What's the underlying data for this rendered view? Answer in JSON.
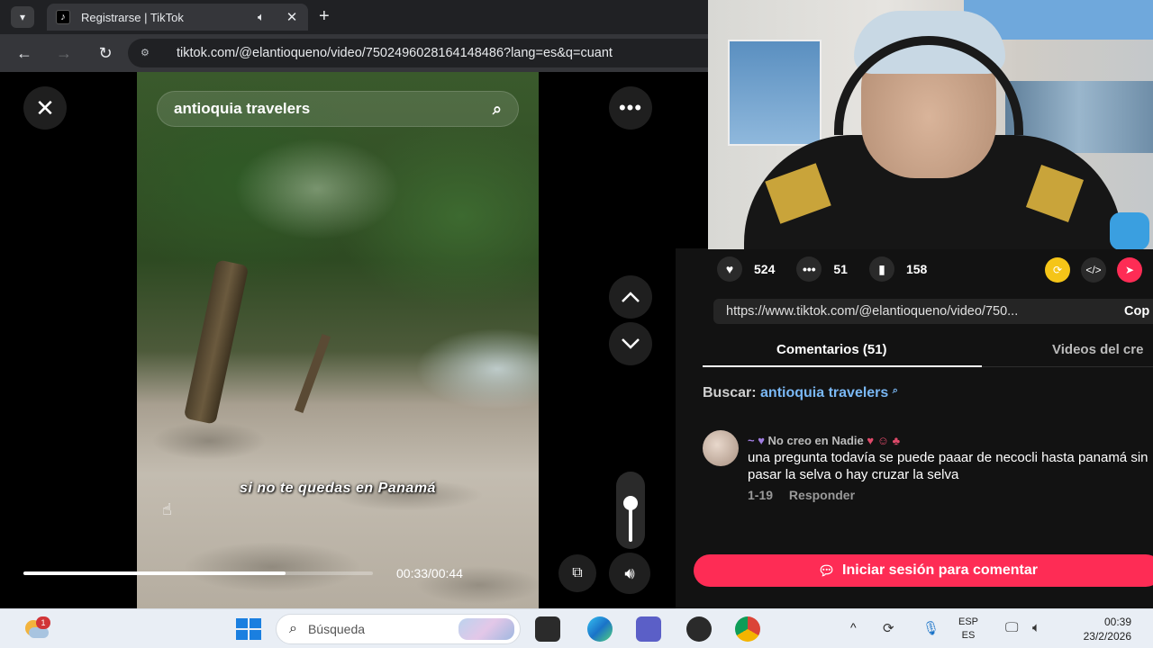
{
  "browser": {
    "tab_title": "Registrarse | TikTok",
    "favicon": "tiktok-logo-icon",
    "url": "tiktok.com/@elantioqueno/video/7502496028164148486?lang=es&q=cuant",
    "icons": [
      "tab-list-icon",
      "speaker-icon",
      "close-icon",
      "new-tab-icon",
      "back-icon",
      "forward-icon",
      "reload-icon",
      "site-info-icon"
    ]
  },
  "player": {
    "search_text": "antioquia travelers",
    "caption": "si no te quedas en Panamá",
    "time": "00:33/00:44",
    "progress": 0.75,
    "volume": 0.62
  },
  "stats": {
    "likes": "524",
    "comments": "51",
    "saves": "158"
  },
  "share_url": "https://www.tiktok.com/@elantioqueno/video/750...",
  "copy_label": "Cop",
  "tabs": {
    "comments": "Comentarios (51)",
    "creator_videos": "Videos del cre"
  },
  "search_line": {
    "prefix": "Buscar:",
    "keyword": "antioquia travelers"
  },
  "comment": {
    "user": "No creo en Nadie",
    "text": "una pregunta todavía se puede paaar de necocli hasta panamá sin pasar la selva o hay cruzar la selva",
    "date": "1-19",
    "reply": "Responder"
  },
  "login_button": "Iniciar sesión para comentar",
  "taskbar": {
    "weather_badge": "1",
    "search_placeholder": "Búsqueda",
    "lang_top": "ESP",
    "lang_bottom": "ES",
    "time": "00:39",
    "date": "23/2/2026"
  },
  "colors": {
    "brand": "#fe2c55",
    "link": "#7ab8f5"
  }
}
